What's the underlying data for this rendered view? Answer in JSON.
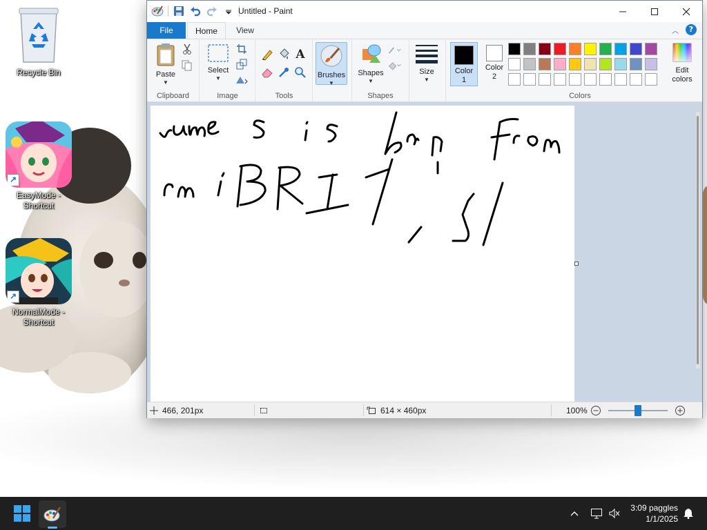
{
  "desktop": {
    "icons": [
      {
        "label": "Recycle Bin"
      },
      {
        "label": "EasyMode - Shortcut"
      },
      {
        "label": "NormalMode - Shortcut"
      }
    ]
  },
  "window": {
    "title": "Untitled - Paint",
    "tabs": {
      "file": "File",
      "home": "Home",
      "view": "View"
    },
    "help_glyph": "?"
  },
  "ribbon": {
    "clipboard": {
      "paste": "Paste",
      "group": "Clipboard"
    },
    "image": {
      "select": "Select",
      "group": "Image"
    },
    "tools": {
      "group": "Tools"
    },
    "brushes": {
      "label": "Brushes"
    },
    "shapes": {
      "label": "Shapes",
      "group": "Shapes"
    },
    "size": {
      "label": "Size"
    },
    "colors": {
      "color1_label": "Color",
      "color1_num": "1",
      "color2_label": "Color",
      "color2_num": "2",
      "edit_label": "Edit",
      "edit_label2": "colors",
      "group": "Colors",
      "color1_value": "#000000",
      "color2_value": "#ffffff",
      "palette": [
        "#000000",
        "#7f7f7f",
        "#880015",
        "#ed1c24",
        "#ff7f27",
        "#fff200",
        "#22b14c",
        "#00a2e8",
        "#3f48cc",
        "#a349a4",
        "#ffffff",
        "#c3c3c3",
        "#b97a57",
        "#ffaec9",
        "#ffc90e",
        "#efe4b0",
        "#b5e61d",
        "#99d9ea",
        "#7092be",
        "#c8bfe7",
        "#ffffff",
        "#ffffff",
        "#ffffff",
        "#ffffff",
        "#ffffff",
        "#ffffff",
        "#ffffff",
        "#ffffff",
        "#ffffff",
        "#ffffff"
      ]
    }
  },
  "statusbar": {
    "cursor_pos": "466, 201px",
    "canvas_size": "614 × 460px",
    "zoom": "100%"
  },
  "taskbar": {
    "time": "3:09 paggles",
    "date": "1/1/2025"
  }
}
